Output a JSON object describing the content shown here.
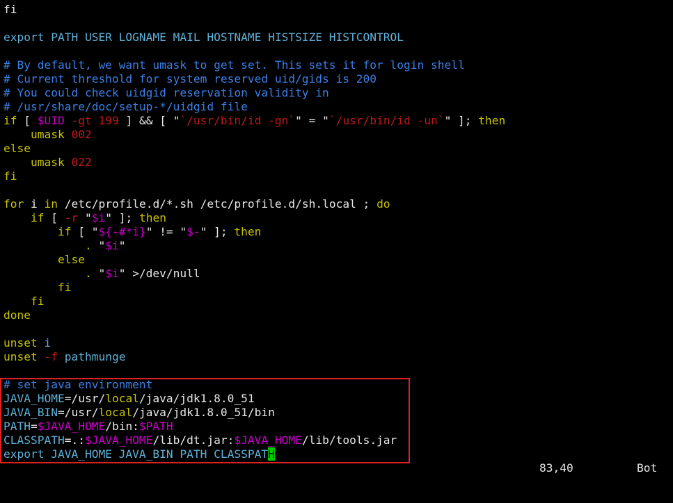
{
  "app": {
    "type": "vim-terminal",
    "colors": {
      "background": "#000000",
      "text": "#e8e8e8",
      "keyword": "#c7c400",
      "command": "#5fb0d8",
      "comment": "#3c7fe6",
      "variable": "#c800c8",
      "string": "#c01818",
      "cursor": "#00d000",
      "highlight_box": "#e02020"
    }
  },
  "lines": [
    [
      {
        "t": "fi",
        "c": "default"
      }
    ],
    [],
    [
      {
        "t": "export PATH USER LOGNAME MAIL HOSTNAME HISTSIZE HISTCONTROL",
        "c": "cmd"
      }
    ],
    [],
    [
      {
        "t": "# By default, we want umask to get set. This sets it for login shell",
        "c": "comment"
      }
    ],
    [
      {
        "t": "# Current threshold for system reserved uid/gids is 200",
        "c": "comment"
      }
    ],
    [
      {
        "t": "# You could check uidgid reservation validity in",
        "c": "comment"
      }
    ],
    [
      {
        "t": "# /usr/share/doc/setup-*/uidgid file",
        "c": "comment"
      }
    ],
    [
      {
        "t": "if",
        "c": "keyword"
      },
      {
        "t": " [ ",
        "c": "default"
      },
      {
        "t": "$UID",
        "c": "var"
      },
      {
        "t": " -gt ",
        "c": "op"
      },
      {
        "t": "199",
        "c": "string"
      },
      {
        "t": " ] && [ ",
        "c": "default"
      },
      {
        "t": "\"",
        "c": "default"
      },
      {
        "t": "`/usr/bin/id -gn`",
        "c": "string"
      },
      {
        "t": "\"",
        "c": "default"
      },
      {
        "t": " = ",
        "c": "default"
      },
      {
        "t": "\"",
        "c": "default"
      },
      {
        "t": "`/usr/bin/id -un`",
        "c": "string"
      },
      {
        "t": "\"",
        "c": "default"
      },
      {
        "t": " ]; ",
        "c": "default"
      },
      {
        "t": "then",
        "c": "keyword"
      }
    ],
    [
      {
        "t": "    umask ",
        "c": "keyword"
      },
      {
        "t": "002",
        "c": "string"
      }
    ],
    [
      {
        "t": "else",
        "c": "keyword"
      }
    ],
    [
      {
        "t": "    umask ",
        "c": "keyword"
      },
      {
        "t": "022",
        "c": "string"
      }
    ],
    [
      {
        "t": "fi",
        "c": "keyword"
      }
    ],
    [],
    [
      {
        "t": "for",
        "c": "keyword"
      },
      {
        "t": " i ",
        "c": "default"
      },
      {
        "t": "in",
        "c": "keyword"
      },
      {
        "t": " /etc/profile.d/*.sh /etc/profile.d/sh.local ; ",
        "c": "default"
      },
      {
        "t": "do",
        "c": "keyword"
      }
    ],
    [
      {
        "t": "    ",
        "c": "default"
      },
      {
        "t": "if",
        "c": "keyword"
      },
      {
        "t": " [ ",
        "c": "default"
      },
      {
        "t": "-r",
        "c": "op"
      },
      {
        "t": " \"",
        "c": "default"
      },
      {
        "t": "$i",
        "c": "var"
      },
      {
        "t": "\" ]; ",
        "c": "default"
      },
      {
        "t": "then",
        "c": "keyword"
      }
    ],
    [
      {
        "t": "        ",
        "c": "default"
      },
      {
        "t": "if",
        "c": "keyword"
      },
      {
        "t": " [ \"",
        "c": "default"
      },
      {
        "t": "${-#*i}",
        "c": "var"
      },
      {
        "t": "\" != \"",
        "c": "default"
      },
      {
        "t": "$-",
        "c": "var"
      },
      {
        "t": "\" ]; ",
        "c": "default"
      },
      {
        "t": "then",
        "c": "keyword"
      }
    ],
    [
      {
        "t": "            ",
        "c": "default"
      },
      {
        "t": ".",
        "c": "keyword"
      },
      {
        "t": " \"",
        "c": "default"
      },
      {
        "t": "$i",
        "c": "var"
      },
      {
        "t": "\"",
        "c": "default"
      }
    ],
    [
      {
        "t": "        ",
        "c": "default"
      },
      {
        "t": "else",
        "c": "keyword"
      }
    ],
    [
      {
        "t": "            ",
        "c": "default"
      },
      {
        "t": ".",
        "c": "keyword"
      },
      {
        "t": " \"",
        "c": "default"
      },
      {
        "t": "$i",
        "c": "var"
      },
      {
        "t": "\" >/dev/null",
        "c": "default"
      }
    ],
    [
      {
        "t": "        ",
        "c": "default"
      },
      {
        "t": "fi",
        "c": "keyword"
      }
    ],
    [
      {
        "t": "    ",
        "c": "default"
      },
      {
        "t": "fi",
        "c": "keyword"
      }
    ],
    [
      {
        "t": "done",
        "c": "keyword"
      }
    ],
    [],
    [
      {
        "t": "unset",
        "c": "keyword"
      },
      {
        "t": " i",
        "c": "cmd"
      }
    ],
    [
      {
        "t": "unset",
        "c": "keyword"
      },
      {
        "t": " -f",
        "c": "op"
      },
      {
        "t": " pathmunge",
        "c": "cmd"
      }
    ],
    [],
    [
      {
        "t": "# set java environment",
        "c": "comment"
      }
    ],
    [
      {
        "t": "JAVA_HOME",
        "c": "cmd"
      },
      {
        "t": "=/usr/",
        "c": "default"
      },
      {
        "t": "local",
        "c": "keyword"
      },
      {
        "t": "/java/jdk1.8.0_51",
        "c": "default"
      }
    ],
    [
      {
        "t": "JAVA_BIN",
        "c": "cmd"
      },
      {
        "t": "=/usr/",
        "c": "default"
      },
      {
        "t": "local",
        "c": "keyword"
      },
      {
        "t": "/java/jdk1.8.0_51/bin",
        "c": "default"
      }
    ],
    [
      {
        "t": "PATH",
        "c": "cmd"
      },
      {
        "t": "=",
        "c": "default"
      },
      {
        "t": "$JAVA_HOME",
        "c": "var"
      },
      {
        "t": "/bin:",
        "c": "default"
      },
      {
        "t": "$PATH",
        "c": "var"
      }
    ],
    [
      {
        "t": "CLASSPATH",
        "c": "cmd"
      },
      {
        "t": "=.:",
        "c": "default"
      },
      {
        "t": "$JAVA_HOME",
        "c": "var"
      },
      {
        "t": "/lib/dt.jar:",
        "c": "default"
      },
      {
        "t": "$JAVA_HOME",
        "c": "var"
      },
      {
        "t": "/lib/tools.jar",
        "c": "default"
      }
    ],
    [
      {
        "t": "export JAVA_HOME JAVA_BIN PATH CLASSPAT",
        "c": "cmd"
      },
      {
        "t": "H",
        "c": "cursor"
      }
    ]
  ],
  "statusline": {
    "cursor_position": "83,40",
    "scroll_position": "Bot"
  }
}
